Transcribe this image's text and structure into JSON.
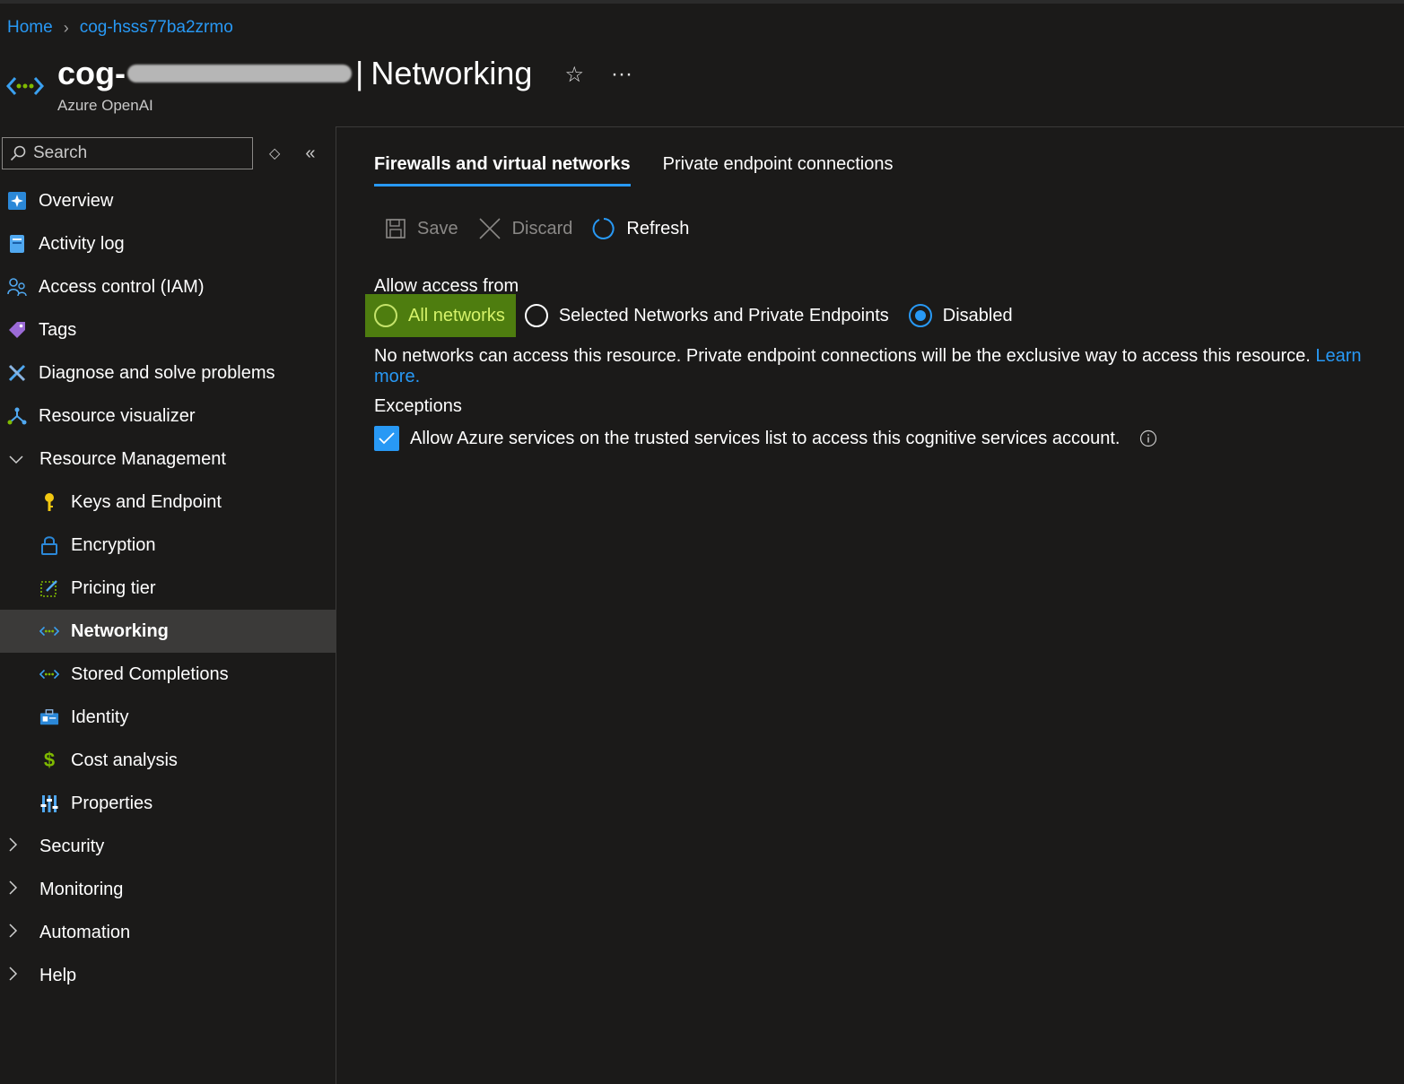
{
  "breadcrumb": {
    "home": "Home",
    "resource": "cog-hsss77ba2zrmo"
  },
  "header": {
    "title_prefix": "cog-",
    "title_separator": "|",
    "title_page": "Networking",
    "subtitle": "Azure OpenAI",
    "favorite_icon": "star-icon",
    "more_icon": "ellipsis-icon",
    "more_glyph": "···"
  },
  "sidebar": {
    "search_placeholder": "Search",
    "items": [
      {
        "label": "Overview",
        "icon": "overview-icon"
      },
      {
        "label": "Activity log",
        "icon": "activity-log-icon"
      },
      {
        "label": "Access control (IAM)",
        "icon": "iam-icon"
      },
      {
        "label": "Tags",
        "icon": "tag-icon"
      },
      {
        "label": "Diagnose and solve problems",
        "icon": "wrench-icon"
      },
      {
        "label": "Resource visualizer",
        "icon": "visualizer-icon"
      },
      {
        "label": "Resource Management",
        "icon": "chevron-down-icon"
      },
      {
        "label": "Keys and Endpoint",
        "icon": "key-icon"
      },
      {
        "label": "Encryption",
        "icon": "lock-icon"
      },
      {
        "label": "Pricing tier",
        "icon": "edit-icon"
      },
      {
        "label": "Networking",
        "icon": "networking-icon"
      },
      {
        "label": "Stored Completions",
        "icon": "networking-icon"
      },
      {
        "label": "Identity",
        "icon": "identity-icon"
      },
      {
        "label": "Cost analysis",
        "icon": "cost-icon"
      },
      {
        "label": "Properties",
        "icon": "properties-icon"
      },
      {
        "label": "Security",
        "icon": "chevron-right-icon"
      },
      {
        "label": "Monitoring",
        "icon": "chevron-right-icon"
      },
      {
        "label": "Automation",
        "icon": "chevron-right-icon"
      },
      {
        "label": "Help",
        "icon": "chevron-right-icon"
      }
    ]
  },
  "main": {
    "tabs": [
      {
        "label": "Firewalls and virtual networks",
        "active": true
      },
      {
        "label": "Private endpoint connections",
        "active": false
      }
    ],
    "toolbar": {
      "save": "Save",
      "discard": "Discard",
      "refresh": "Refresh"
    },
    "allow_access_label": "Allow access from",
    "options": [
      {
        "label": "All networks",
        "selected": false
      },
      {
        "label": "Selected Networks and Private Endpoints",
        "selected": false
      },
      {
        "label": "Disabled",
        "selected": true
      }
    ],
    "description": "No networks can access this resource. Private endpoint connections will be the exclusive way to access this resource.",
    "learn_more": "Learn more.",
    "exceptions_label": "Exceptions",
    "exception_checkbox_label": "Allow Azure services on the trusted services list to access this cognitive services account.",
    "exception_checked": true
  },
  "colors": {
    "accent": "#2899f5",
    "highlight": "#4e7d0f",
    "background": "#1b1a19"
  }
}
